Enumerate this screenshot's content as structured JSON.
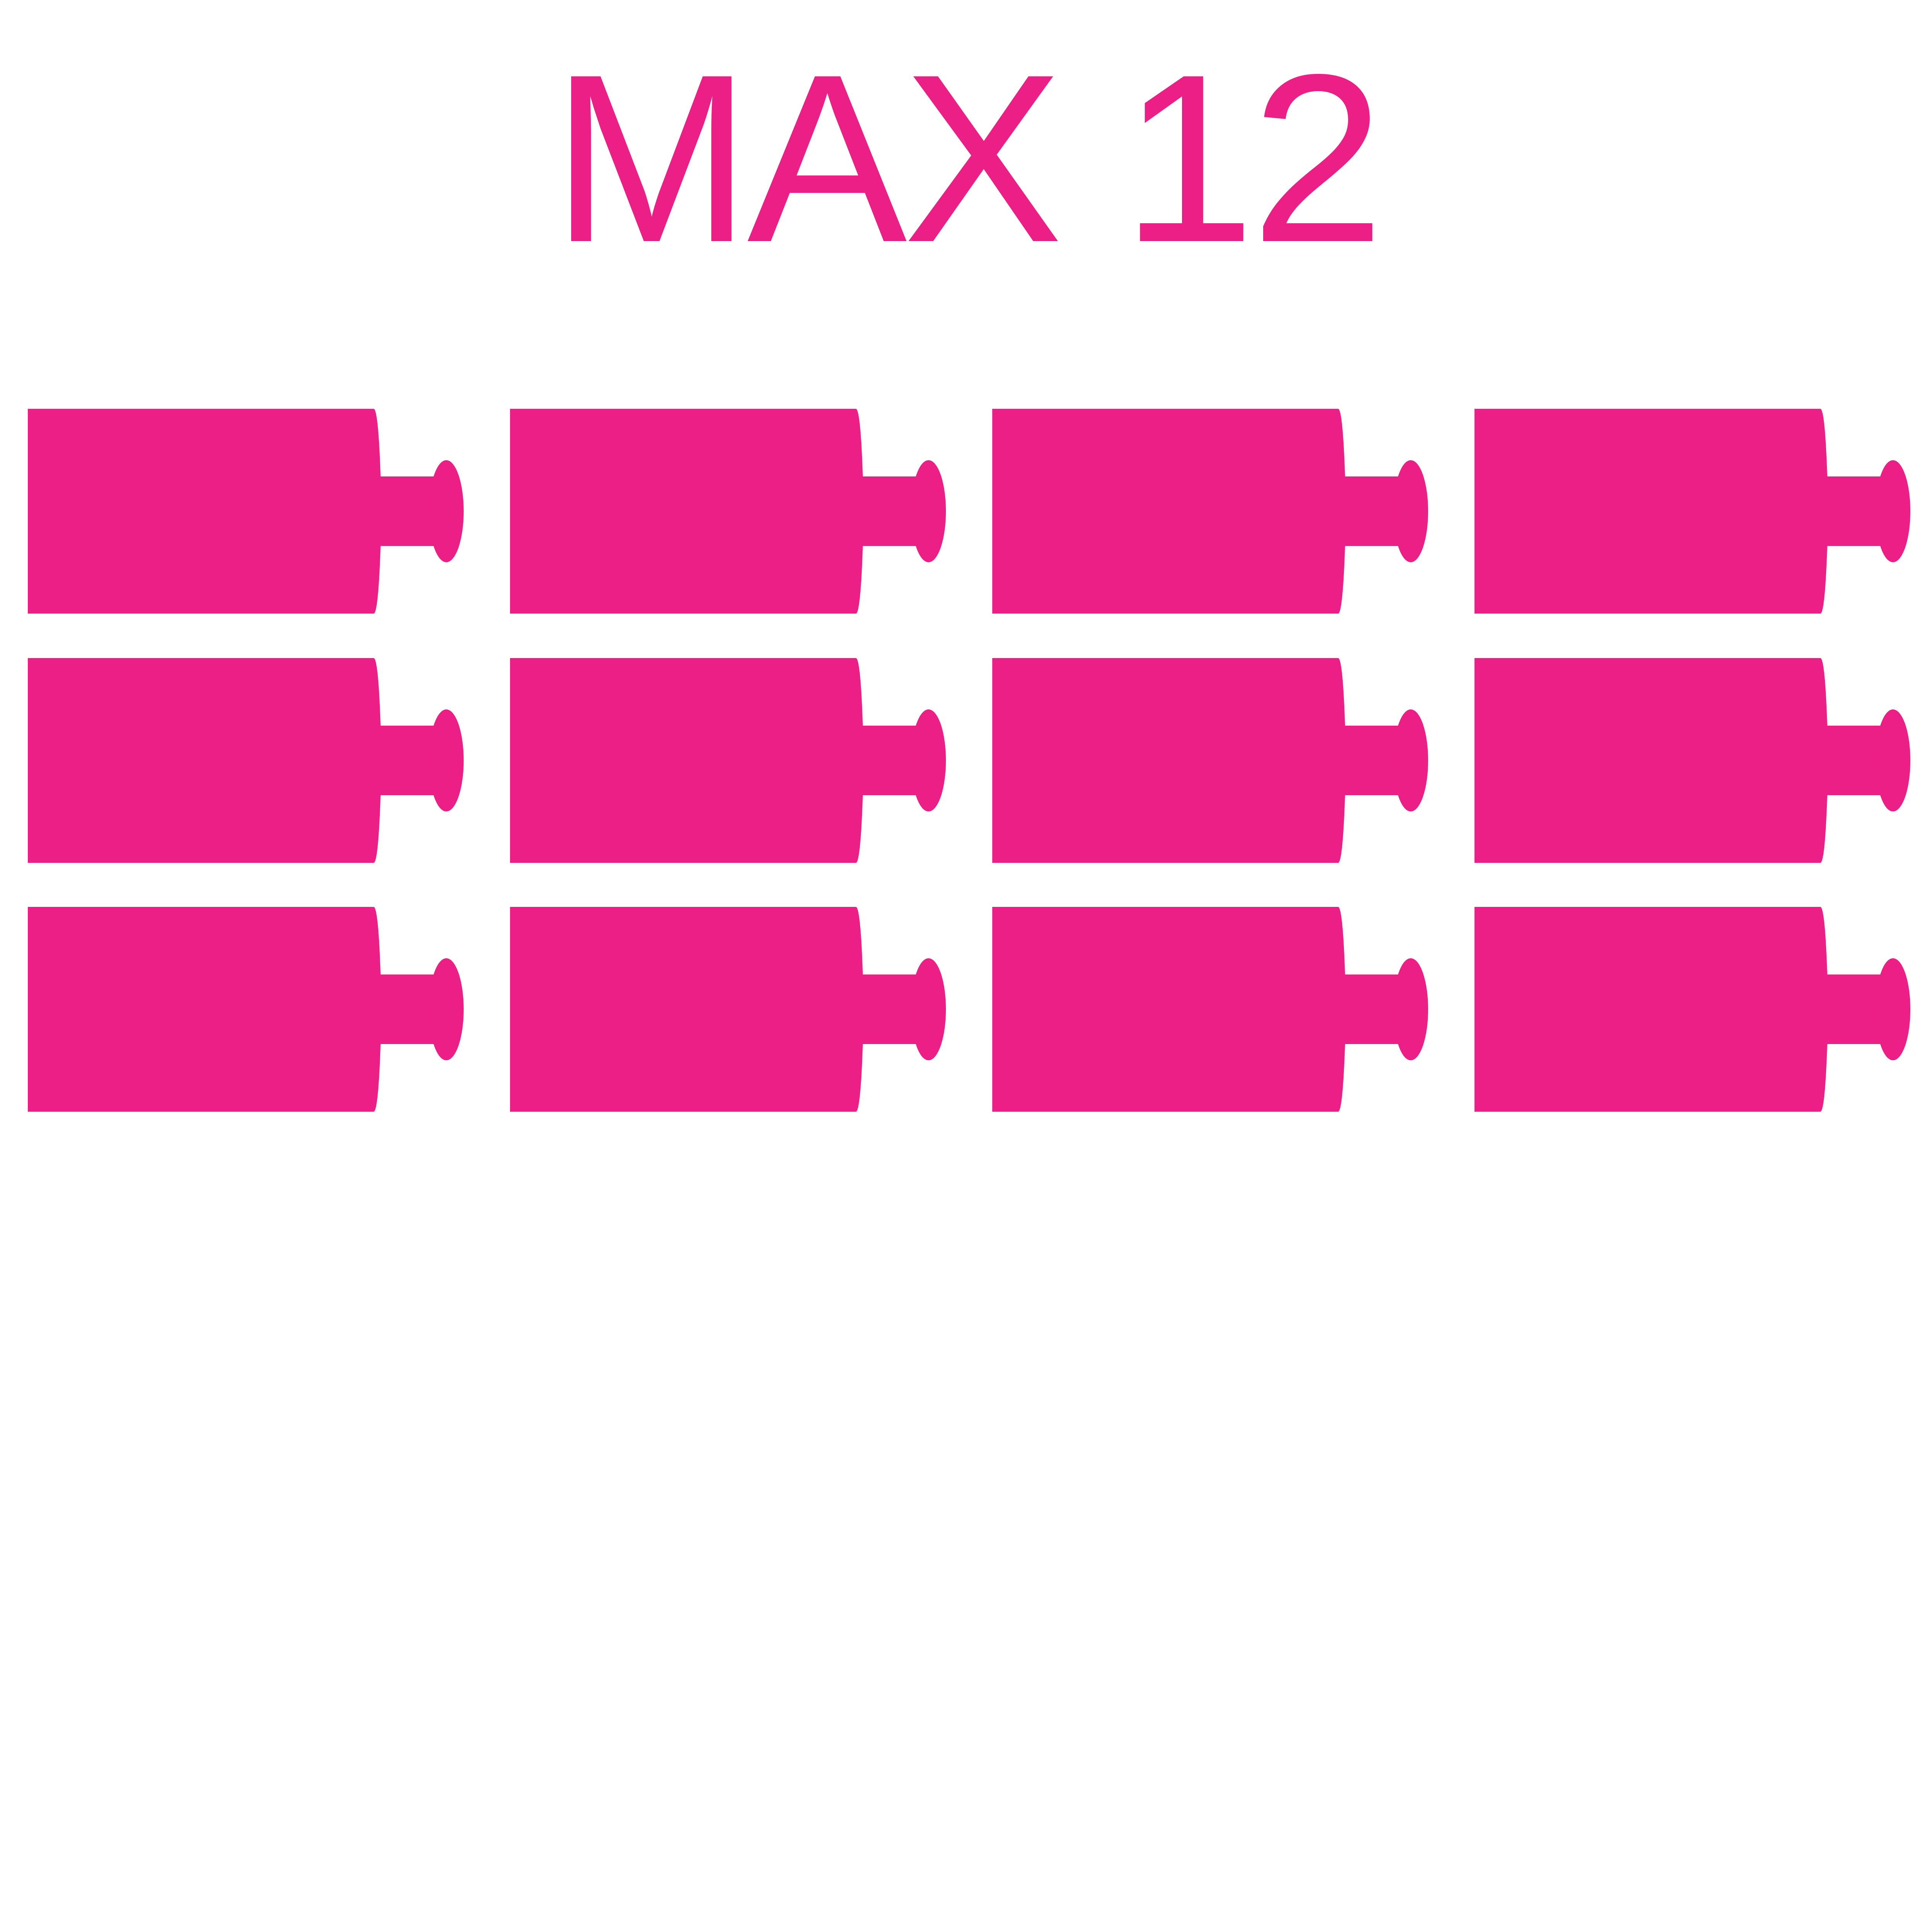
{
  "title": "MAX 12",
  "accent_color": "#ec1f86",
  "background_color": "#ffffff",
  "icon": "bottle-icon",
  "bottle_count": 12
}
